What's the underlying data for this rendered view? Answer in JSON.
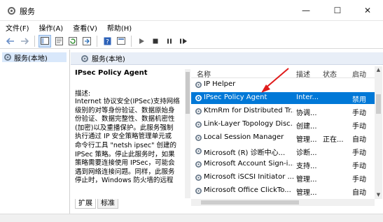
{
  "window": {
    "title": "服务",
    "minimize_glyph": "—",
    "maximize_glyph": "☐",
    "close_glyph": "✕"
  },
  "menu": {
    "file": "文件(F)",
    "action": "操作(A)",
    "view": "查看(V)",
    "help": "帮助(H)"
  },
  "toolbar": {
    "icons": [
      "back-arrow-icon",
      "forward-arrow-icon",
      "show-hide-tree-icon",
      "properties-icon",
      "refresh-icon",
      "export-icon",
      "help-icon",
      "view-icon",
      "start-icon",
      "stop-icon",
      "pause-icon",
      "restart-icon"
    ]
  },
  "tree": {
    "root_label": "服务(本地)"
  },
  "pane": {
    "header": "服务(本地)"
  },
  "description": {
    "service_name": "IPsec Policy Agent",
    "label": "描述:",
    "text": "Internet 协议安全(IPSec)支持网络\n级别的对等身份验证、数据原始身\n份验证、数据完整性、数据机密性\n(加密)以及重播保护。此服务强制\n执行通过 IP 安全策略管理单元或\n命令行工具 \"netsh ipsec\" 创建的\nIPSec 策略。停止此服务时，如果\n策略需要连接使用 IPSec，可能会\n遇到网络连接问题。同样，此服务\n停止时，Windows 防火墙的远程"
  },
  "services_list": {
    "columns": {
      "name": "名称",
      "desc": "描述",
      "status": "状态",
      "startup": "启动"
    },
    "rows": [
      {
        "name": "IP Helper",
        "desc": "",
        "status": "",
        "startup": ""
      },
      {
        "name": "IPsec Policy Agent",
        "desc": "Inter...",
        "status": "",
        "startup": "禁用"
      },
      {
        "name": "KtmRm for Distributed Tr...",
        "desc": "协调...",
        "status": "",
        "startup": "手动"
      },
      {
        "name": "Link-Layer Topology Disc...",
        "desc": "创建...",
        "status": "",
        "startup": "手动"
      },
      {
        "name": "Local Session Manager",
        "desc": "管理...",
        "status": "正在...",
        "startup": "自动"
      },
      {
        "name": "Microsoft (R) 诊断中心...",
        "desc": "诊断...",
        "status": "",
        "startup": "手动"
      },
      {
        "name": "Microsoft Account Sign-i...",
        "desc": "支持...",
        "status": "",
        "startup": "手动"
      },
      {
        "name": "Microsoft iSCSI Initiator ...",
        "desc": "管理...",
        "status": "",
        "startup": "手动"
      },
      {
        "name": "Microsoft Office ClickTo...",
        "desc": "管理...",
        "status": "",
        "startup": "自动"
      }
    ],
    "selected_index": 1
  },
  "tabs": {
    "extended": "扩展",
    "standard": "标准"
  },
  "colors": {
    "selection": "#0078d7",
    "annotation_arrow": "#e01b1b"
  }
}
